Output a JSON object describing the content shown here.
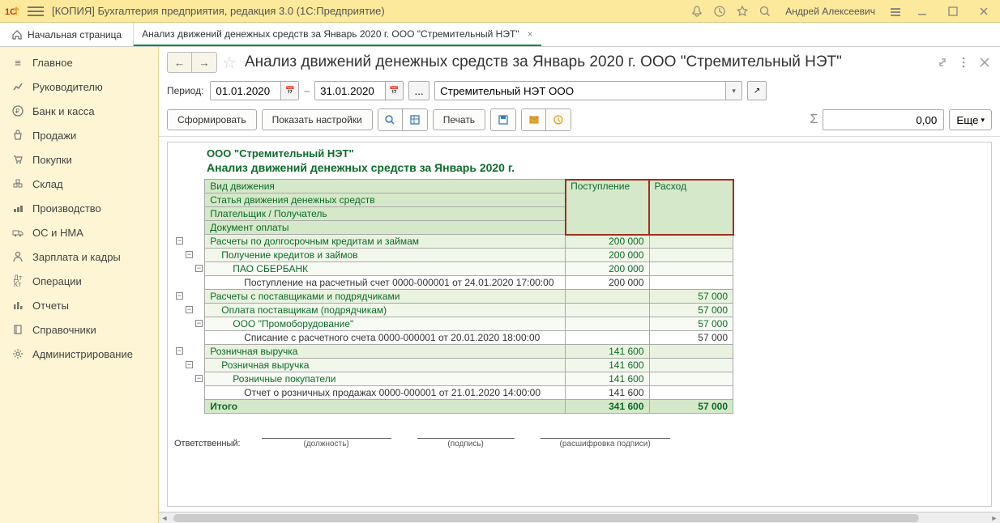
{
  "window_title": "[КОПИЯ] Бухгалтерия предприятия, редакция 3.0  (1С:Предприятие)",
  "username": "Андрей Алексеевич",
  "home_tab": "Начальная страница",
  "doc_tab": "Анализ движений денежных средств за Январь 2020 г. ООО \"Стремительный НЭТ\"",
  "page_title": "Анализ движений денежных средств за Январь 2020 г. ООО \"Стремительный НЭТ\"",
  "sidebar": {
    "items": [
      {
        "label": "Главное"
      },
      {
        "label": "Руководителю"
      },
      {
        "label": "Банк и касса"
      },
      {
        "label": "Продажи"
      },
      {
        "label": "Покупки"
      },
      {
        "label": "Склад"
      },
      {
        "label": "Производство"
      },
      {
        "label": "ОС и НМА"
      },
      {
        "label": "Зарплата и кадры"
      },
      {
        "label": "Операции"
      },
      {
        "label": "Отчеты"
      },
      {
        "label": "Справочники"
      },
      {
        "label": "Администрирование"
      }
    ]
  },
  "period": {
    "label": "Период:",
    "from": "01.01.2020",
    "to": "31.01.2020",
    "dash": "–"
  },
  "org_value": "Стремительный НЭТ ООО",
  "buttons": {
    "generate": "Сформировать",
    "show_settings": "Показать настройки",
    "print": "Печать",
    "more": "Еще"
  },
  "sum_value": "0,00",
  "report": {
    "org_line": "ООО \"Стремительный НЭТ\"",
    "title": "Анализ движений денежных средств за Январь 2020 г.",
    "header_rows": [
      "Вид движения",
      "Статья движения денежных средств",
      "Плательщик / Получатель",
      "Документ оплаты"
    ],
    "col_in": "Поступление",
    "col_out": "Расход",
    "rows": [
      {
        "level": 0,
        "desc": "Расчеты по долгосрочным кредитам и займам",
        "in": "200 000",
        "out": ""
      },
      {
        "level": 1,
        "desc": "Получение кредитов и займов",
        "in": "200 000",
        "out": ""
      },
      {
        "level": 2,
        "desc": "ПАО СБЕРБАНК",
        "in": "200 000",
        "out": ""
      },
      {
        "level": 3,
        "desc": "Поступление на расчетный счет 0000-000001 от 24.01.2020 17:00:00",
        "in": "200 000",
        "out": ""
      },
      {
        "level": 0,
        "desc": "Расчеты с поставщиками и подрядчиками",
        "in": "",
        "out": "57 000"
      },
      {
        "level": 1,
        "desc": "Оплата поставщикам (подрядчикам)",
        "in": "",
        "out": "57 000"
      },
      {
        "level": 2,
        "desc": "ООО \"Промоборудование\"",
        "in": "",
        "out": "57 000"
      },
      {
        "level": 3,
        "desc": "Списание с расчетного счета 0000-000001 от 20.01.2020 18:00:00",
        "in": "",
        "out": "57 000"
      },
      {
        "level": 0,
        "desc": "Розничная выручка",
        "in": "141 600",
        "out": ""
      },
      {
        "level": 1,
        "desc": "Розничная выручка",
        "in": "141 600",
        "out": ""
      },
      {
        "level": 2,
        "desc": "Розничные покупатели",
        "in": "141 600",
        "out": ""
      },
      {
        "level": 3,
        "desc": "Отчет о розничных продажах 0000-000001 от 21.01.2020 14:00:00",
        "in": "141 600",
        "out": ""
      }
    ],
    "total": {
      "label": "Итого",
      "in": "341 600",
      "out": "57 000"
    },
    "signature": {
      "responsible": "Ответственный:",
      "position": "(должность)",
      "sign": "(подпись)",
      "decipher": "(расшифровка подписи)"
    }
  }
}
